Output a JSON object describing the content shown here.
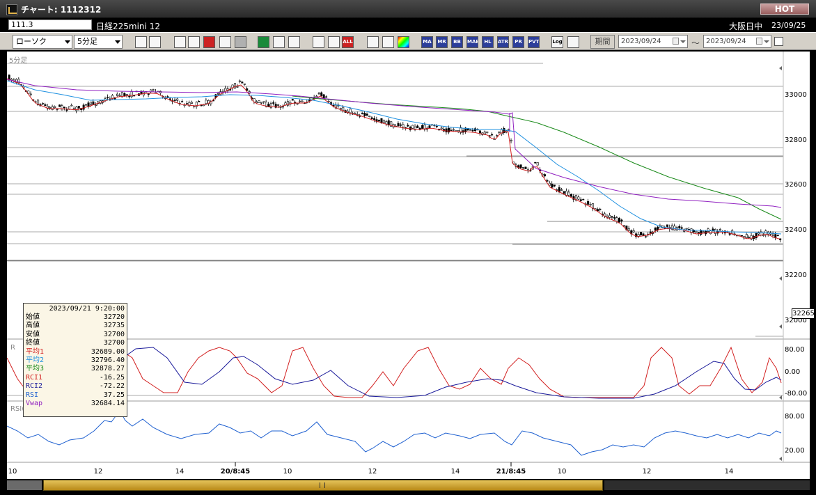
{
  "window": {
    "title": "チャート: 1112312",
    "hot_label": "HOT"
  },
  "infobar": {
    "symbol_code": "111.3",
    "product_name": "日経225mini 12",
    "session_label": "大阪日中",
    "session_date": "23/09/25"
  },
  "toolbar": {
    "chart_type": "ローソク",
    "interval": "5分足",
    "period_label": "期間",
    "date_from": "2023/09/24",
    "date_to": "2023/09/24",
    "tilde": "〜",
    "buttons": [
      {
        "name": "zoom-icon",
        "label": "",
        "style": "white"
      },
      {
        "name": "crosshair-icon",
        "label": "",
        "style": "white"
      },
      {
        "name": "line-draw-icon",
        "label": "",
        "style": "white"
      },
      {
        "name": "search-chart-icon",
        "label": "",
        "style": "white"
      },
      {
        "name": "grid-icon",
        "label": "",
        "style": "red"
      },
      {
        "name": "candle-settings-icon",
        "label": "",
        "style": "white"
      },
      {
        "name": "disabled-icon",
        "label": "",
        "style": "gray"
      },
      {
        "name": "trendline-icon",
        "label": "",
        "style": "green"
      },
      {
        "name": "cursor-icon",
        "label": "",
        "style": "white"
      },
      {
        "name": "redo-icon",
        "label": "",
        "style": "white"
      },
      {
        "name": "candle-left-icon",
        "label": "",
        "style": "white"
      },
      {
        "name": "candle-right-icon",
        "label": "",
        "style": "white"
      },
      {
        "name": "all-button",
        "label": "ALL",
        "style": "red"
      },
      {
        "name": "tools-icon",
        "label": "",
        "style": "white"
      },
      {
        "name": "pencil-icon",
        "label": "",
        "style": "white"
      },
      {
        "name": "color-icon",
        "label": "",
        "style": "rainbow"
      },
      {
        "name": "ma-indicator-icon",
        "label": "MA",
        "style": "blue"
      },
      {
        "name": "mr-button",
        "label": "MR",
        "style": "blue"
      },
      {
        "name": "bb-button",
        "label": "BB",
        "style": "blue"
      },
      {
        "name": "mae-button",
        "label": "MAE",
        "style": "blue"
      },
      {
        "name": "hl-button",
        "label": "HL",
        "style": "blue"
      },
      {
        "name": "atr-button",
        "label": "ATR",
        "style": "blue"
      },
      {
        "name": "pr-button",
        "label": "PR",
        "style": "blue"
      },
      {
        "name": "pvt-button",
        "label": "PVT",
        "style": "blue"
      },
      {
        "name": "log-button",
        "label": "Log",
        "style": "white"
      },
      {
        "name": "chart-window-icon",
        "label": "",
        "style": "white"
      }
    ]
  },
  "chart": {
    "interval_label": "5分足",
    "price_ticks": [
      "33000",
      "32800",
      "32600",
      "32400",
      "32200",
      "32000"
    ],
    "current_price": "32265",
    "rci_ticks": [
      "80.00",
      "0.00",
      "-80.00"
    ],
    "rsi_label": "RSI(14)",
    "rsi_ticks": [
      "80.00",
      "20.00"
    ],
    "rci_panel_letter": "R",
    "x_labels": [
      {
        "text": "10",
        "bold": false
      },
      {
        "text": "12",
        "bold": false
      },
      {
        "text": "14",
        "bold": false
      },
      {
        "text": "20/8:45",
        "bold": true
      },
      {
        "text": "10",
        "bold": false
      },
      {
        "text": "12",
        "bold": false
      },
      {
        "text": "14",
        "bold": false
      },
      {
        "text": "21/8:45",
        "bold": true
      },
      {
        "text": "10",
        "bold": false
      },
      {
        "text": "12",
        "bold": false
      },
      {
        "text": "14",
        "bold": false
      }
    ],
    "colors": {
      "ma1": "#d22020",
      "ma2": "#1e90e0",
      "ma3": "#1a8a1a",
      "vwap": "#9020c0",
      "rci1": "#d22020",
      "rci2": "#1a1a9a",
      "rsi": "#1e60d0"
    }
  },
  "tooltip": {
    "datetime": "2023/09/21 9:20:00",
    "rows": [
      {
        "label": "始値",
        "value": "32720",
        "color": "#000000"
      },
      {
        "label": "高値",
        "value": "32735",
        "color": "#000000"
      },
      {
        "label": "安値",
        "value": "32700",
        "color": "#000000"
      },
      {
        "label": "終値",
        "value": "32700",
        "color": "#000000"
      },
      {
        "label": "平均1",
        "value": "32689.00",
        "color": "#d22020"
      },
      {
        "label": "平均2",
        "value": "32796.40",
        "color": "#1e90e0"
      },
      {
        "label": "平均3",
        "value": "32878.27",
        "color": "#1a8a1a"
      },
      {
        "label": "RCI1",
        "value": "-16.25",
        "color": "#d22020"
      },
      {
        "label": "RCI2",
        "value": "-72.22",
        "color": "#1a1a9a"
      },
      {
        "label": "RSI",
        "value": "37.25",
        "color": "#1e60d0"
      },
      {
        "label": "Vwap",
        "value": "32684.14",
        "color": "#9020c0"
      }
    ]
  }
}
